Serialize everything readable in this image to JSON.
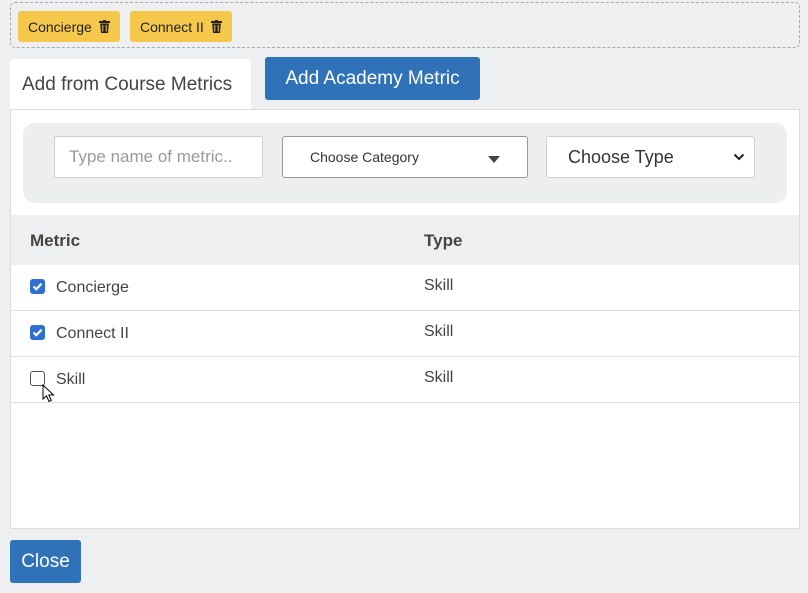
{
  "selected_chips": [
    {
      "label": "Concierge"
    },
    {
      "label": "Connect II"
    }
  ],
  "tabs": {
    "course_metrics_label": "Add from Course Metrics",
    "academy_metric_label": "Add Academy Metric"
  },
  "filters": {
    "search_placeholder": "Type name of metric..",
    "category_label": "Choose Category",
    "type_label": "Choose Type"
  },
  "table": {
    "headers": {
      "metric": "Metric",
      "type": "Type"
    },
    "rows": [
      {
        "metric": "Concierge",
        "type": "Skill",
        "checked": true
      },
      {
        "metric": "Connect II",
        "type": "Skill",
        "checked": true
      },
      {
        "metric": "Skill",
        "type": "Skill",
        "checked": false
      }
    ]
  },
  "footer": {
    "close_label": "Close"
  },
  "colors": {
    "chip": "#f5c84c",
    "primary": "#2f72b7",
    "checkbox": "#2f6fd0"
  }
}
